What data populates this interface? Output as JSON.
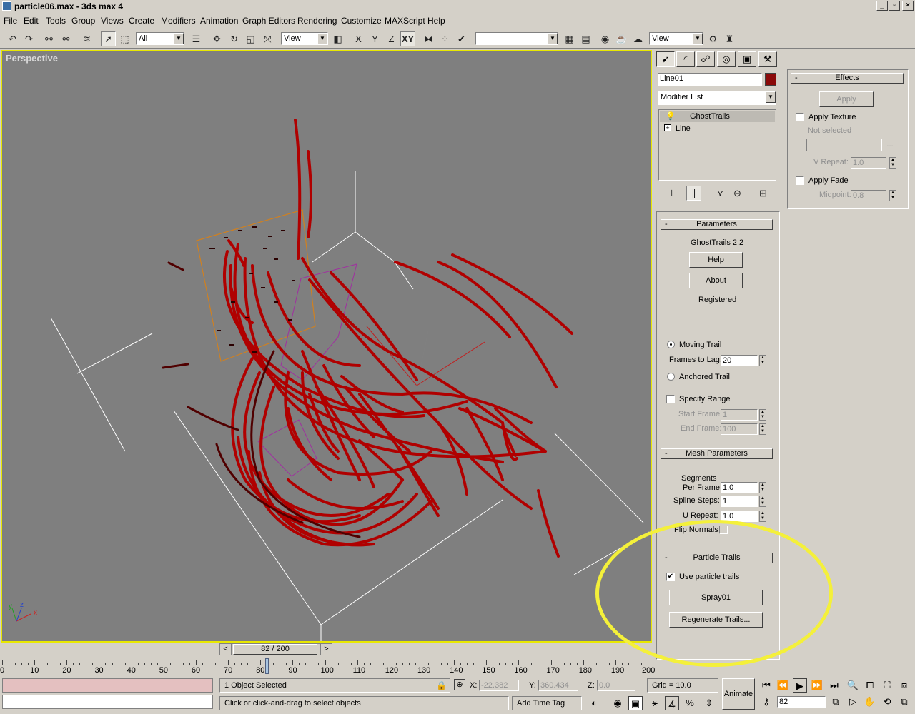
{
  "window": {
    "title": "particle06.max - 3ds max 4",
    "controls": [
      "_",
      "▫",
      "×"
    ]
  },
  "menu": [
    "File",
    "Edit",
    "Tools",
    "Group",
    "Views",
    "Create",
    "Modifiers",
    "Animation",
    "Graph Editors",
    "Rendering",
    "Customize",
    "MAXScript",
    "Help"
  ],
  "toolbar": {
    "selection_filter": "All",
    "ref_coord": "View",
    "axis_x": "X",
    "axis_y": "Y",
    "axis_z": "Z",
    "axis_xy": "XY",
    "named_selection": "",
    "render_view": "View"
  },
  "viewport": {
    "label": "Perspective",
    "gizmo": {
      "x": "x",
      "y": "y",
      "z": "z"
    }
  },
  "command_panel": {
    "object_name": "Line01",
    "object_color": "#8b0a0a",
    "modifier_list_label": "Modifier List",
    "stack": [
      "GhostTrails",
      "Line"
    ],
    "parameters": {
      "header": "Parameters",
      "version": "GhostTrails 2.2",
      "help": "Help",
      "about": "About",
      "registered": "Registered",
      "moving_trail": "Moving Trail",
      "frames_to_lag_label": "Frames to Lag:",
      "frames_to_lag": "20",
      "anchored_trail": "Anchored Trail",
      "specify_range": "Specify Range",
      "start_frame_label": "Start Frame:",
      "start_frame": "1",
      "end_frame_label": "End Frame:",
      "end_frame": "100"
    },
    "mesh": {
      "header": "Mesh Parameters",
      "segments_label_1": "Segments",
      "segments_label_2": "Per Frame:",
      "segments": "1.0",
      "spline_steps_label": "Spline Steps:",
      "spline_steps": "1",
      "u_repeat_label": "U Repeat:",
      "u_repeat": "1.0",
      "flip_normals": "Flip Normals"
    },
    "particle": {
      "header": "Particle Trails",
      "use_particle_trails": "Use particle trails",
      "spray_button": "Spray01",
      "regenerate_button": "Regenerate Trails..."
    }
  },
  "effects": {
    "header": "Effects",
    "apply": "Apply",
    "apply_texture": "Apply Texture",
    "not_selected": "Not selected",
    "browse": "...",
    "v_repeat_label": "V Repeat:",
    "v_repeat": "1.0",
    "apply_fade": "Apply Fade",
    "midpoint_label": "Midpoint:",
    "midpoint": "0.8"
  },
  "timeline": {
    "slider_label": "82 / 200",
    "prev": "<",
    "next": ">",
    "ruler": [
      "0",
      "10",
      "20",
      "30",
      "40",
      "50",
      "60",
      "70",
      "80",
      "90",
      "100",
      "110",
      "120",
      "130",
      "140",
      "150",
      "160",
      "170",
      "180",
      "190",
      "200"
    ]
  },
  "status": {
    "selection": "1 Object Selected",
    "prompt": "Click or click-and-drag to select objects",
    "x_label": "X:",
    "x": "-22.382",
    "y_label": "Y:",
    "y": "360.434",
    "z_label": "Z:",
    "z": "0.0",
    "grid": "Grid = 10.0",
    "add_time_tag": "Add Time Tag",
    "animate": "Animate",
    "current_frame": "82"
  }
}
